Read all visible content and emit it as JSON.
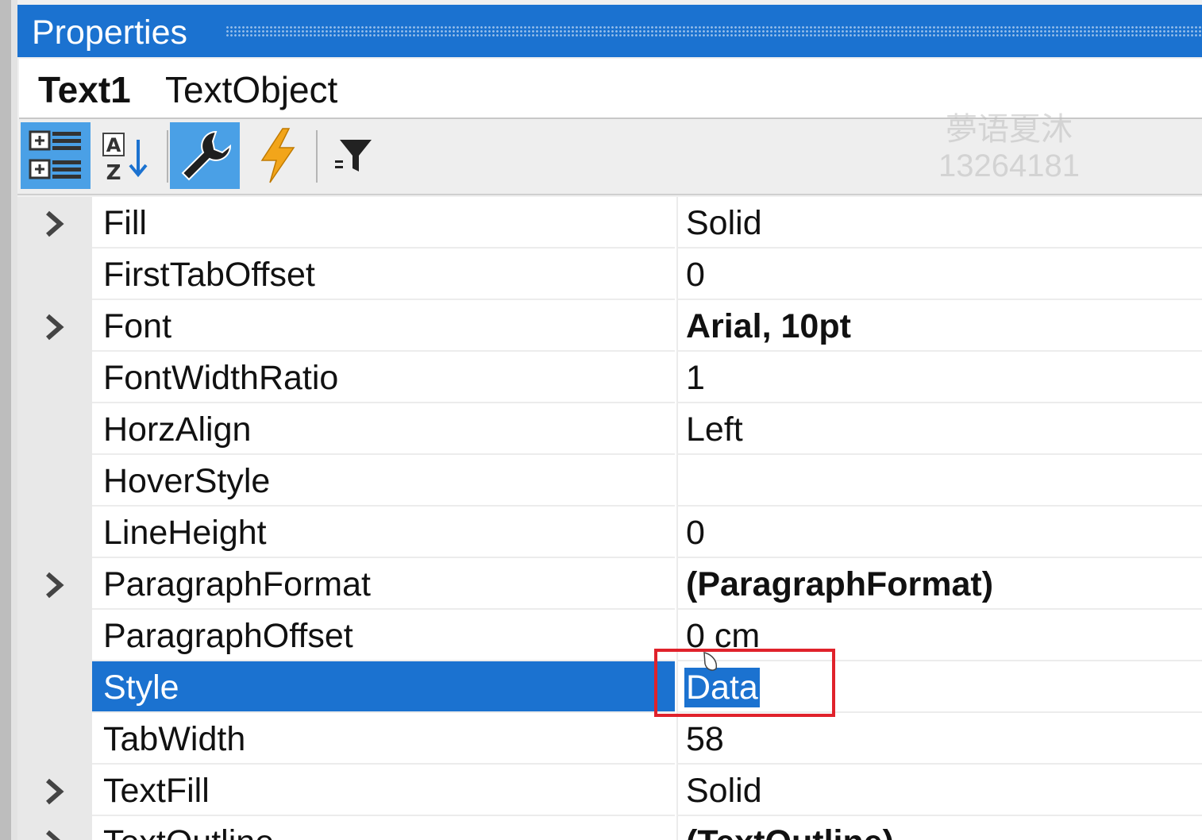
{
  "panel": {
    "title": "Properties"
  },
  "object": {
    "name": "Text1",
    "type": "TextObject"
  },
  "toolbar": {
    "buttons": [
      {
        "icon": "categorized-icon",
        "active": true
      },
      {
        "icon": "alphabetical-sort-icon",
        "active": false
      },
      {
        "icon": "wrench-properties-icon",
        "active": true
      },
      {
        "icon": "lightning-events-icon",
        "active": false
      },
      {
        "icon": "filter-icon",
        "active": false
      }
    ]
  },
  "watermark": {
    "line1": "夢语夏沐",
    "line2": "13264181"
  },
  "properties": [
    {
      "name": "Fill",
      "value": "Solid",
      "expandable": true,
      "bold": false
    },
    {
      "name": "FirstTabOffset",
      "value": "0",
      "expandable": false,
      "bold": false
    },
    {
      "name": "Font",
      "value": "Arial, 10pt",
      "expandable": true,
      "bold": true
    },
    {
      "name": "FontWidthRatio",
      "value": "1",
      "expandable": false,
      "bold": false
    },
    {
      "name": "HorzAlign",
      "value": "Left",
      "expandable": false,
      "bold": false
    },
    {
      "name": "HoverStyle",
      "value": "",
      "expandable": false,
      "bold": false
    },
    {
      "name": "LineHeight",
      "value": "0",
      "expandable": false,
      "bold": false
    },
    {
      "name": "ParagraphFormat",
      "value": "(ParagraphFormat)",
      "expandable": true,
      "bold": true
    },
    {
      "name": "ParagraphOffset",
      "value": "0 cm",
      "expandable": false,
      "bold": false
    },
    {
      "name": "Style",
      "value": "Data",
      "expandable": false,
      "bold": false,
      "selected": true
    },
    {
      "name": "TabWidth",
      "value": "58",
      "expandable": false,
      "bold": false
    },
    {
      "name": "TextFill",
      "value": "Solid",
      "expandable": true,
      "bold": false
    },
    {
      "name": "TextOutline",
      "value": "(TextOutline)",
      "expandable": true,
      "bold": true
    }
  ],
  "colors": {
    "accent": "#1b72d0",
    "highlight_box": "#e0222b",
    "lightning": "#f2a51a"
  }
}
